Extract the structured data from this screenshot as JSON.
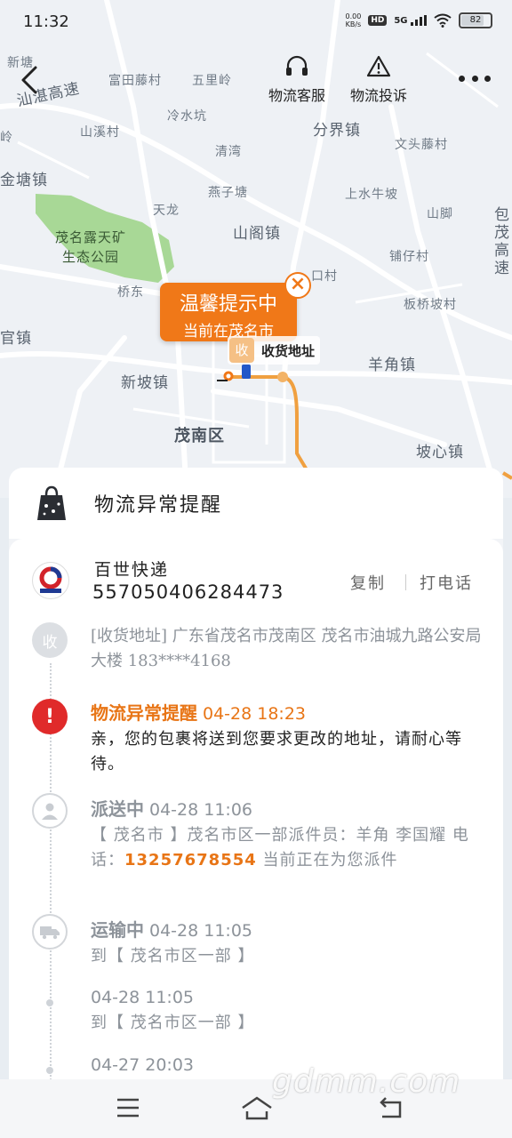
{
  "status_bar": {
    "time": "11:32",
    "net_speed_value": "0.00",
    "net_speed_unit": "KB/s",
    "hd": "HD",
    "signal": "5G",
    "battery": "82"
  },
  "top_nav": {
    "service_label": "物流客服",
    "complaint_label": "物流投诉"
  },
  "map": {
    "labels": {
      "shantan_expressway": "汕湛高速",
      "futian": "富田藤村",
      "wuli": "五里岭",
      "lengshuikeng": "冷水坑",
      "shanxicun": "山溪村",
      "qingwan": "清湾",
      "fenjiezhen": "分界镇",
      "wenjian": "文头藤村",
      "jinqiao": "金塘镇",
      "yanzitang": "燕子塘",
      "shangshuiniu": "上水牛坡",
      "tianlong": "天龙",
      "shanjiao": "山脚",
      "shangelzhen": "山阁镇",
      "park_line1": "茂名露天矿",
      "park_line2": "生态公园",
      "puzicun": "铺仔村",
      "banqiao": "板桥坡村",
      "qiaodong": "桥东",
      "xiaokoucun": "口村",
      "guanzhen": "官镇",
      "yangjiao": "羊角镇",
      "xinpo": "新坡镇",
      "maonan": "茂南区",
      "poxin": "坡心镇",
      "ridge_left": "岭",
      "top_left": "新塘",
      "right_edge": "包茂高速"
    },
    "tip_title": "温馨提示中",
    "tip_subtitle": "当前在茂名市",
    "close_symbol": "×",
    "address_pin_badge": "收",
    "address_pin_label": "收货地址"
  },
  "sheet": {
    "title": "物流异常提醒",
    "courier_name": "百世快递",
    "tracking_number": "557050406284473",
    "copy_label": "复制",
    "call_label": "打电话",
    "address_badge": "收",
    "address_text": "[收货地址] 广东省茂名市茂南区  茂名市油城九路公安局大楼 183****4168",
    "events": [
      {
        "status": "物流异常提醒",
        "time": "04-28 18:23",
        "body": "亲，您的包裹将送到您要求更改的地址，请耐心等待。"
      },
      {
        "status": "派送中",
        "time": "04-28 11:06",
        "body_prefix": "【 茂名市 】茂名市区一部派件员：羊角 李国耀 电话：",
        "phone": "13257678554",
        "body_suffix": " 当前正在为您派件"
      },
      {
        "status": "运输中",
        "time": "04-28 11:05",
        "body": "到【 茂名市区一部 】"
      },
      {
        "status": "",
        "time": "04-28 11:05",
        "body": "到【 茂名市区一部 】"
      },
      {
        "status": "",
        "time": "04-27 20:03",
        "body": ""
      }
    ]
  },
  "watermark": "gdmm.com",
  "colors": {
    "accent_orange": "#f07818",
    "alert_red": "#e02a2a",
    "route_orange": "#f0a040",
    "park_green": "#9ed28a"
  }
}
